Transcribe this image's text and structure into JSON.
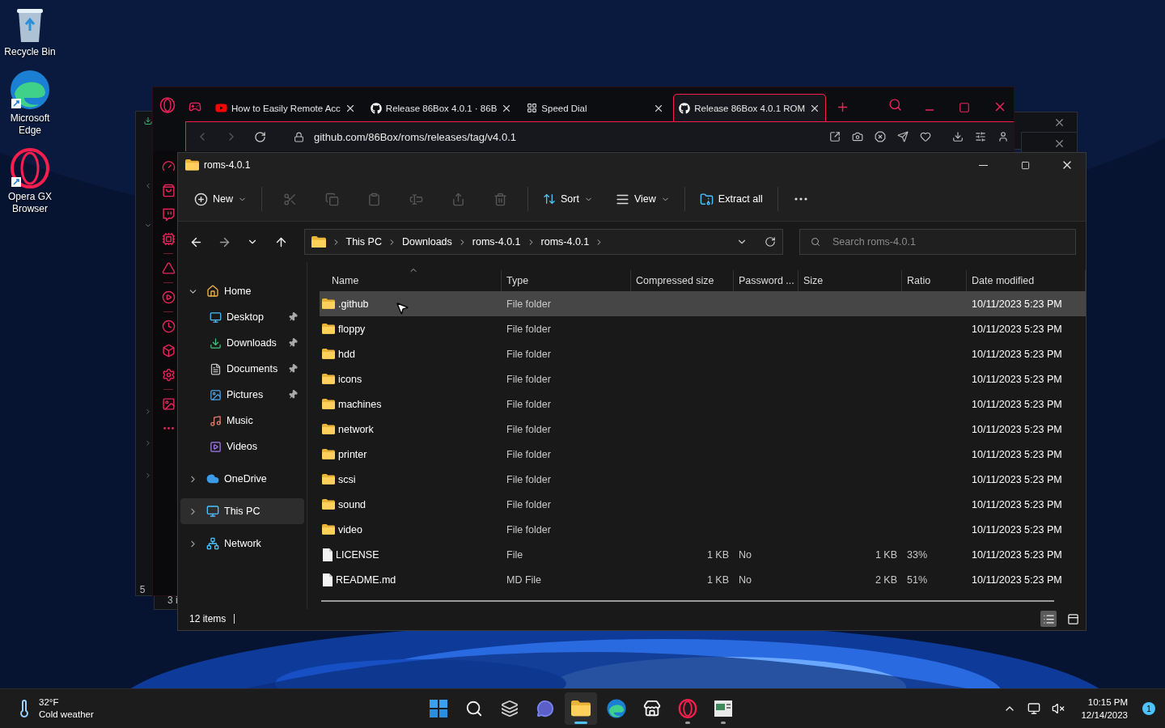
{
  "desktop_icons": [
    {
      "label": "Recycle Bin",
      "kind": "bin"
    },
    {
      "label": "Microsoft Edge",
      "kind": "edge"
    },
    {
      "label": "Opera GX Browser",
      "kind": "opera"
    }
  ],
  "background_windows": [
    {
      "kind": "left",
      "text": "5"
    },
    {
      "kind": "bottom",
      "text": "3 i"
    },
    {
      "kind": "right"
    },
    {
      "kind": "right_lower"
    }
  ],
  "browser": {
    "tabs": [
      {
        "title": "How to Easily Remote Acc",
        "kind": "video",
        "selected": false
      },
      {
        "title": "Release 86Box 4.0.1 · 86B",
        "kind": "site",
        "selected": false
      },
      {
        "title": "Speed Dial",
        "kind": "dial",
        "selected": false
      },
      {
        "title": "Release 86Box 4.0.1 ROM",
        "kind": "site",
        "selected": true
      }
    ],
    "url": "github.com/86Box/roms/releases/tag/v4.0.1"
  },
  "explorer": {
    "title": "roms-4.0.1",
    "toolbar": {
      "new": "New",
      "clipboard_actions": [
        {
          "disabled": true
        },
        {
          "disabled": true
        },
        {
          "disabled": true
        },
        {
          "disabled": true
        },
        {
          "disabled": true
        },
        {
          "disabled": true
        }
      ],
      "sort": "Sort",
      "view": "View",
      "extract": "Extract all"
    },
    "nav_buttons": [
      {
        "disabled": false
      },
      {
        "disabled": true
      },
      {
        "disabled": false
      },
      {
        "disabled": false
      }
    ],
    "breadcrumb": [
      "This PC",
      "Downloads",
      "roms-4.0.1",
      "roms-4.0.1"
    ],
    "search": {
      "placeholder": "Search roms-4.0.1"
    },
    "sidebar": [
      {
        "label": "Home",
        "expanded": true,
        "selected": false,
        "children": [
          {
            "label": "Desktop",
            "pinned": true,
            "selected": false
          },
          {
            "label": "Downloads",
            "pinned": true,
            "selected": false
          },
          {
            "label": "Documents",
            "pinned": true,
            "selected": false
          },
          {
            "label": "Pictures",
            "pinned": true,
            "selected": false
          },
          {
            "label": "Music",
            "pinned": false,
            "selected": false
          },
          {
            "label": "Videos",
            "pinned": false,
            "selected": false
          }
        ]
      },
      {
        "label": "OneDrive",
        "expanded": false,
        "selected": false
      },
      {
        "label": "This PC",
        "expanded": false,
        "selected": true
      },
      {
        "label": "Network",
        "expanded": false,
        "selected": false
      }
    ],
    "columns": [
      {
        "label": "Name",
        "sorted": true
      },
      {
        "label": "Type",
        "sorted": false
      },
      {
        "label": "Compressed size",
        "sorted": false
      },
      {
        "label": "Password ...",
        "sorted": false
      },
      {
        "label": "Size",
        "sorted": false
      },
      {
        "label": "Ratio",
        "sorted": false
      },
      {
        "label": "Date modified",
        "sorted": false
      }
    ],
    "rows": [
      {
        "kind": "folder",
        "name": ".github",
        "type": "File folder",
        "date": "10/11/2023 5:23 PM",
        "selected": true
      },
      {
        "kind": "folder",
        "name": "floppy",
        "type": "File folder",
        "date": "10/11/2023 5:23 PM",
        "selected": false
      },
      {
        "kind": "folder",
        "name": "hdd",
        "type": "File folder",
        "date": "10/11/2023 5:23 PM",
        "selected": false
      },
      {
        "kind": "folder",
        "name": "icons",
        "type": "File folder",
        "date": "10/11/2023 5:23 PM",
        "selected": false
      },
      {
        "kind": "folder",
        "name": "machines",
        "type": "File folder",
        "date": "10/11/2023 5:23 PM",
        "selected": false
      },
      {
        "kind": "folder",
        "name": "network",
        "type": "File folder",
        "date": "10/11/2023 5:23 PM",
        "selected": false
      },
      {
        "kind": "folder",
        "name": "printer",
        "type": "File folder",
        "date": "10/11/2023 5:23 PM",
        "selected": false
      },
      {
        "kind": "folder",
        "name": "scsi",
        "type": "File folder",
        "date": "10/11/2023 5:23 PM",
        "selected": false
      },
      {
        "kind": "folder",
        "name": "sound",
        "type": "File folder",
        "date": "10/11/2023 5:23 PM",
        "selected": false
      },
      {
        "kind": "folder",
        "name": "video",
        "type": "File folder",
        "date": "10/11/2023 5:23 PM",
        "selected": false
      },
      {
        "kind": "file",
        "name": "LICENSE",
        "type": "File",
        "compressed_size": "1 KB",
        "password": "No",
        "size": "1 KB",
        "ratio": "33%",
        "date": "10/11/2023 5:23 PM",
        "selected": false
      },
      {
        "kind": "file",
        "name": "README.md",
        "type": "MD File",
        "compressed_size": "1 KB",
        "password": "No",
        "size": "2 KB",
        "ratio": "51%",
        "date": "10/11/2023 5:23 PM",
        "selected": false
      }
    ],
    "status": "12 items",
    "view_modes": [
      {
        "selected": true
      },
      {
        "selected": false
      }
    ]
  },
  "taskbar": {
    "temperature": "32°F",
    "weather": "Cold weather",
    "apps": [
      {
        "running": false,
        "active": false
      },
      {
        "running": false,
        "active": false
      },
      {
        "running": false,
        "active": false
      },
      {
        "running": false,
        "active": false
      },
      {
        "running": true,
        "active": true
      },
      {
        "running": false,
        "active": false
      },
      {
        "running": false,
        "active": false
      },
      {
        "running": true,
        "active": false
      },
      {
        "running": true,
        "active": false
      }
    ],
    "time": "10:15 PM",
    "date": "12/14/2023",
    "notifications": "1"
  }
}
